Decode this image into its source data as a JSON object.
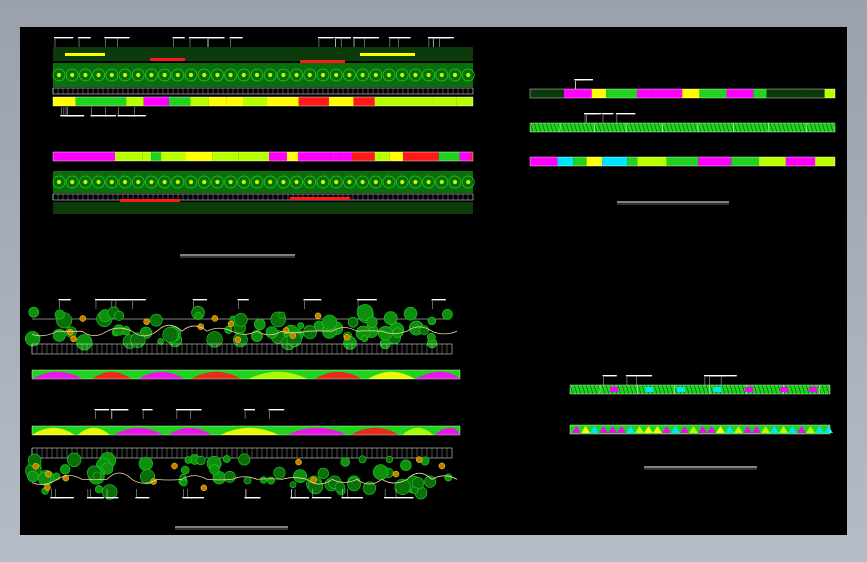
{
  "window": {
    "background": "#a8afb9",
    "sheet_background": "#000000"
  },
  "palette": {
    "green": "#1fd31f",
    "lime": "#b8ff00",
    "dark_green": "#0a6e0a",
    "yellow": "#ffff00",
    "red": "#ff1a1a",
    "magenta": "#ff00ff",
    "cyan": "#00e5ff",
    "white": "#ffffff"
  },
  "panels": [
    {
      "name": "top-left-plan",
      "rows": [
        "canopy",
        "color-band",
        "color-band",
        "canopy"
      ]
    },
    {
      "name": "top-right-plan",
      "rows": [
        "color-band",
        "hatched-band",
        "color-band"
      ]
    },
    {
      "name": "bottom-left-plan",
      "rows": [
        "tree-cluster",
        "color-wave",
        "color-wave",
        "tree-cluster"
      ]
    },
    {
      "name": "bottom-right-plan",
      "rows": [
        "hatched-band",
        "triangle-band"
      ]
    }
  ]
}
